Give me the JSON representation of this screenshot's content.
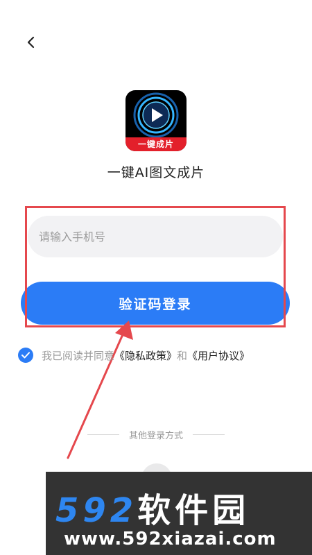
{
  "header": {
    "back_icon": "chevron-left-icon"
  },
  "app": {
    "icon_badge": "一键成片",
    "title": "一键AI图文成片"
  },
  "form": {
    "phone_placeholder": "请输入手机号",
    "phone_value": "",
    "login_button": "验证码登录"
  },
  "agreement": {
    "checked": true,
    "prefix": "我已阅读并同意",
    "privacy_link": "《隐私政策》",
    "conjunction": "和",
    "terms_link": "《用户协议》"
  },
  "other_login": {
    "label": "其他登录方式"
  },
  "watermark": {
    "brand_number": "592",
    "brand_text": "软件园",
    "url": "www.592xiazai.com"
  },
  "colors": {
    "primary": "#2b7cf6",
    "highlight": "#e5484d",
    "icon_ribbon": "#e3202b",
    "input_bg": "#f2f2f4",
    "watermark_bg": "#333333"
  }
}
